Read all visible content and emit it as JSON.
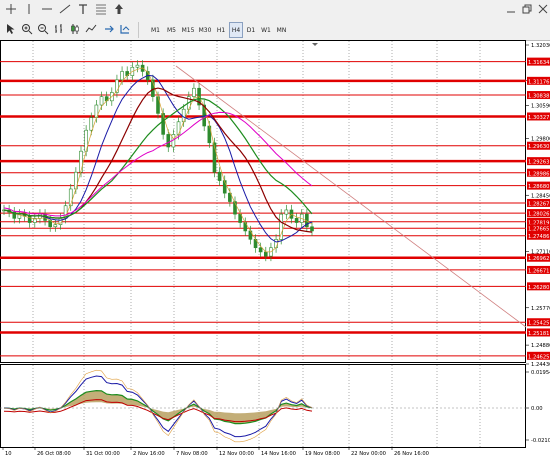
{
  "toolbar": {
    "timeframes": [
      "M1",
      "M5",
      "M15",
      "M30",
      "H1",
      "H4",
      "D1",
      "W1",
      "MN"
    ],
    "active_timeframe": "H4"
  },
  "main_chart": {
    "price_scale": [
      "1.32030",
      "1.31180",
      "1.30590",
      "1.29800",
      "1.28450",
      "1.27110",
      "1.25770",
      "1.24880",
      "1.24430"
    ],
    "level_labels": [
      "1.31634",
      "1.31176",
      "1.30838",
      "1.30327",
      "1.29630",
      "1.29263",
      "1.28986",
      "1.28680",
      "1.28267",
      "1.28026",
      "1.27819",
      "1.27665",
      "1.27486",
      "1.26962",
      "1.26671",
      "1.26280",
      "1.25425",
      "1.25181",
      "1.24625"
    ],
    "time_labels": [
      "10",
      "26 Oct 08:00",
      "31 Oct 00:00",
      "2 Nov 16:00",
      "7 Nov 08:00",
      "12 Nov 00:00",
      "14 Nov 16:00",
      "19 Nov 08:00",
      "22 Nov 00:00",
      "26 Nov 16:00"
    ]
  },
  "oscillator": {
    "scale": [
      "0.01954",
      "0.00",
      "-0.02109"
    ]
  },
  "colors": {
    "level_line": "#e00000",
    "fast_ma": "#1a1aa6",
    "slow_ma": "#8b0000",
    "long_ma": "#1e8c1e",
    "ma_magenta": "#e000c8",
    "trendline": "#d08080",
    "candle": "#2e8b2e"
  }
}
